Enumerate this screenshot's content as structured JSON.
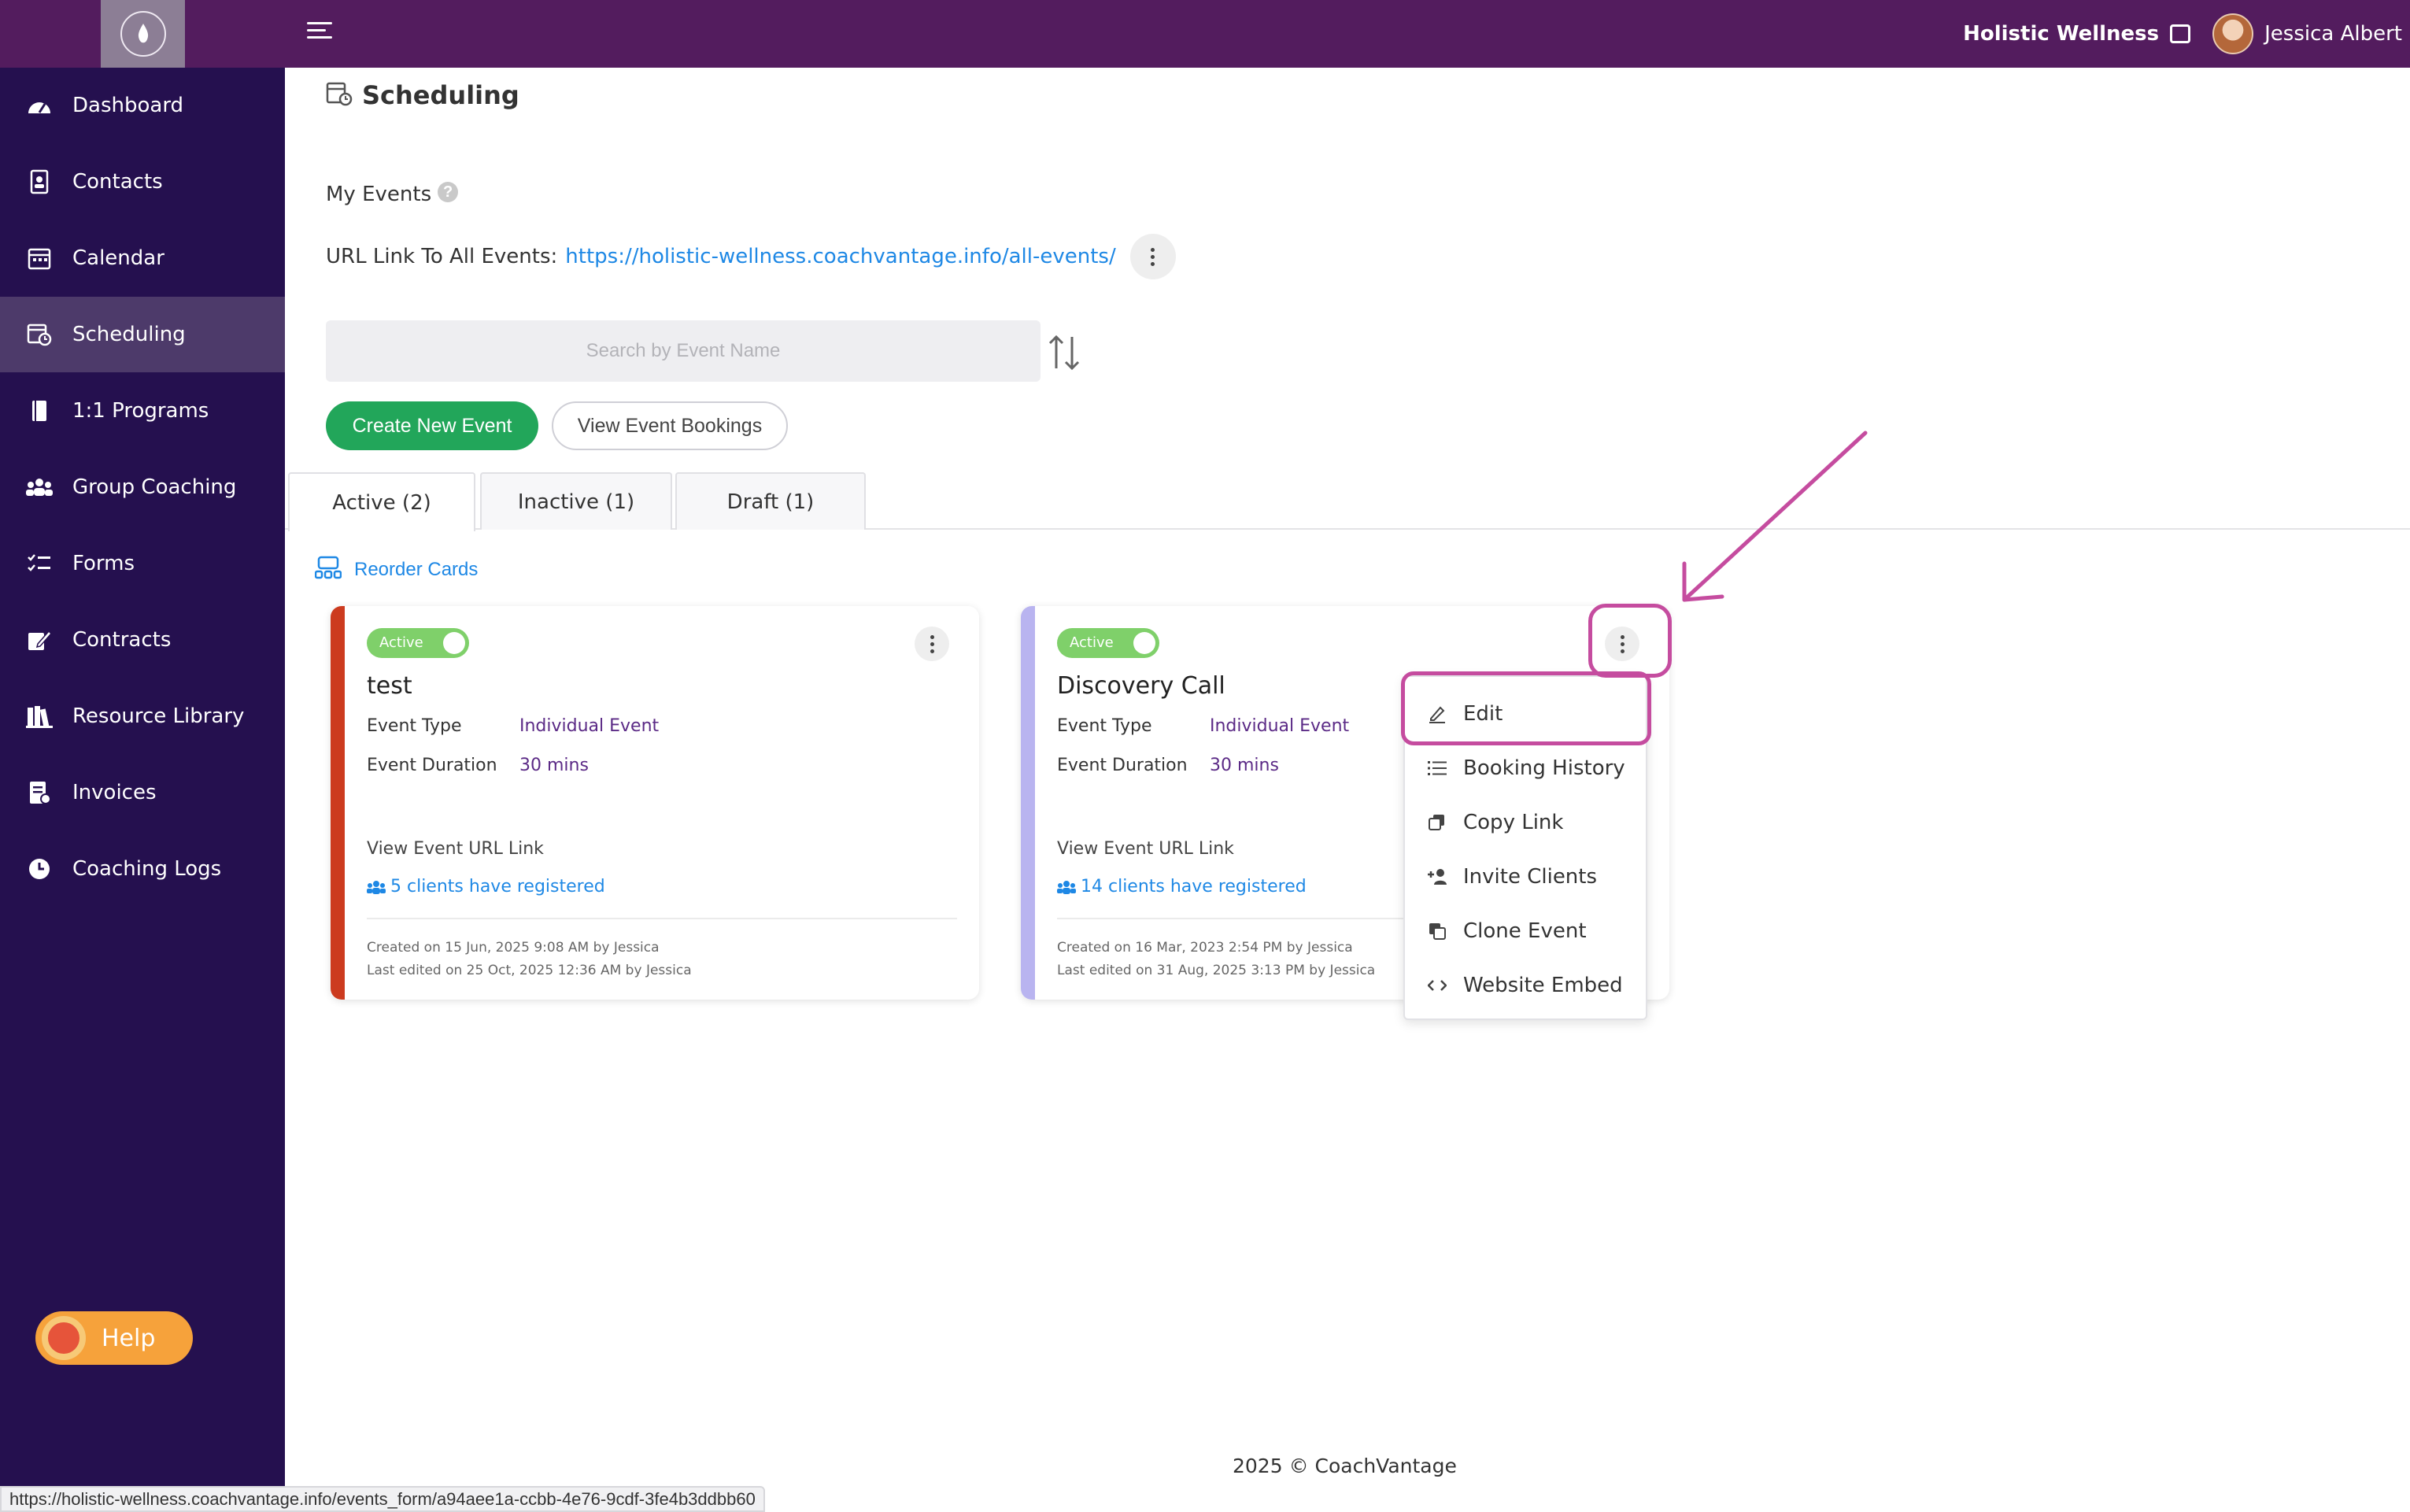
{
  "header": {
    "org_name": "Holistic Wellness",
    "user_name": "Jessica Albert"
  },
  "sidebar": {
    "items": [
      {
        "label": "Dashboard",
        "icon": "dashboard-icon"
      },
      {
        "label": "Contacts",
        "icon": "contacts-icon"
      },
      {
        "label": "Calendar",
        "icon": "calendar-icon"
      },
      {
        "label": "Scheduling",
        "icon": "scheduling-icon",
        "active": true
      },
      {
        "label": "1:1 Programs",
        "icon": "book-icon"
      },
      {
        "label": "Group Coaching",
        "icon": "group-icon"
      },
      {
        "label": "Forms",
        "icon": "forms-icon"
      },
      {
        "label": "Contracts",
        "icon": "contract-icon"
      },
      {
        "label": "Resource Library",
        "icon": "library-icon"
      },
      {
        "label": "Invoices",
        "icon": "invoice-icon"
      },
      {
        "label": "Coaching Logs",
        "icon": "clock-icon"
      }
    ],
    "help_label": "Help"
  },
  "page": {
    "title": "Scheduling",
    "my_events_label": "My Events",
    "url_label": "URL Link To All Events:",
    "url_value": "https://holistic-wellness.coachvantage.info/all-events/",
    "search_placeholder": "Search by Event Name",
    "create_button": "Create New Event",
    "view_bookings_button": "View Event Bookings",
    "tabs": [
      {
        "label": "Active (2)",
        "active": true
      },
      {
        "label": "Inactive (1)"
      },
      {
        "label": "Draft (1)"
      }
    ],
    "reorder_label": "Reorder Cards"
  },
  "cards": [
    {
      "status": "Active",
      "title": "test",
      "type_label": "Event Type",
      "type_value": "Individual Event",
      "duration_label": "Event Duration",
      "duration_value": "30 mins",
      "url_link_label": "View Event URL Link",
      "registered": "5 clients have registered",
      "created": "Created on 15 Jun, 2025 9:08 AM by Jessica",
      "edited": "Last edited on 25 Oct, 2025 12:36 AM by Jessica",
      "accent": "#cc3b1f"
    },
    {
      "status": "Active",
      "title": "Discovery Call",
      "type_label": "Event Type",
      "type_value": "Individual Event",
      "duration_label": "Event Duration",
      "duration_value": "30 mins",
      "url_link_label": "View Event URL Link",
      "registered": "14 clients have registered",
      "created": "Created on 16 Mar, 2023 2:54 PM by Jessica",
      "edited": "Last edited on 31 Aug, 2025 3:13 PM by Jessica",
      "accent": "#b9b4f0"
    }
  ],
  "dropdown": {
    "items": [
      {
        "label": "Edit",
        "icon": "pencil-icon"
      },
      {
        "label": "Booking History",
        "icon": "list-icon"
      },
      {
        "label": "Copy Link",
        "icon": "copy-icon"
      },
      {
        "label": "Invite Clients",
        "icon": "user-plus-icon"
      },
      {
        "label": "Clone Event",
        "icon": "clone-icon"
      },
      {
        "label": "Website Embed",
        "icon": "code-icon"
      }
    ]
  },
  "footer": "2025 © CoachVantage",
  "status_bar_url": "https://holistic-wellness.coachvantage.info/events_form/a94aee1a-ccbb-4e76-9cdf-3fe4b3ddbb60",
  "colors": {
    "topbar": "#531c5e",
    "sidebar": "#25104f",
    "primary_button": "#22a65a",
    "link": "#1e88e5",
    "annotation": "#c54c9f"
  }
}
